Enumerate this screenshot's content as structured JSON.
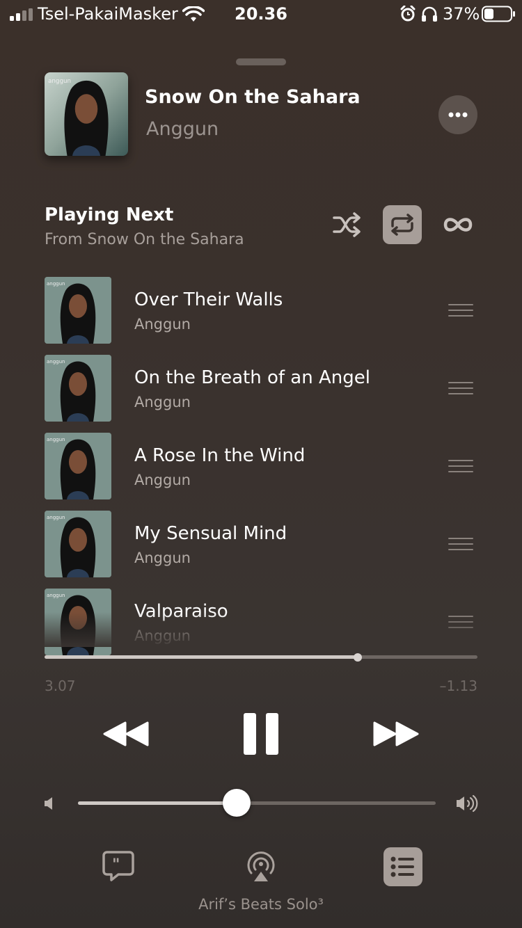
{
  "status_bar": {
    "carrier": "Tsel-PakaiMasker",
    "time": "20.36",
    "battery_percent": "37%",
    "battery_level": 0.37,
    "icons": [
      "signal-icon",
      "wifi-icon",
      "alarm-icon",
      "headphones-icon",
      "battery-icon"
    ]
  },
  "now_playing": {
    "title": "Snow On the Sahara",
    "artist": "Anggun",
    "artwork_text": "anggun",
    "more_icon": "ellipsis-icon"
  },
  "queue": {
    "title": "Playing Next",
    "subtitle": "From Snow On the Sahara",
    "controls": [
      "shuffle-icon",
      "repeat-icon",
      "autoplay-icon"
    ],
    "repeat_active": true,
    "items": [
      {
        "title": "Over Their Walls",
        "artist": "Anggun"
      },
      {
        "title": "On the Breath of an Angel",
        "artist": "Anggun"
      },
      {
        "title": "A Rose In the Wind",
        "artist": "Anggun"
      },
      {
        "title": "My Sensual Mind",
        "artist": "Anggun"
      },
      {
        "title": "Valparaiso",
        "artist": "Anggun"
      }
    ]
  },
  "playback": {
    "elapsed": "3.07",
    "remaining": "–1.13",
    "progress": 0.723
  },
  "volume": {
    "level": 0.444
  },
  "bottom_bar": {
    "device_name": "Arif’s Beats Solo³",
    "icons": [
      "lyrics-icon",
      "airplay-icon",
      "queue-list-icon"
    ]
  },
  "colors": {
    "accent_button": "#a79e99",
    "background": "#3a322e"
  }
}
